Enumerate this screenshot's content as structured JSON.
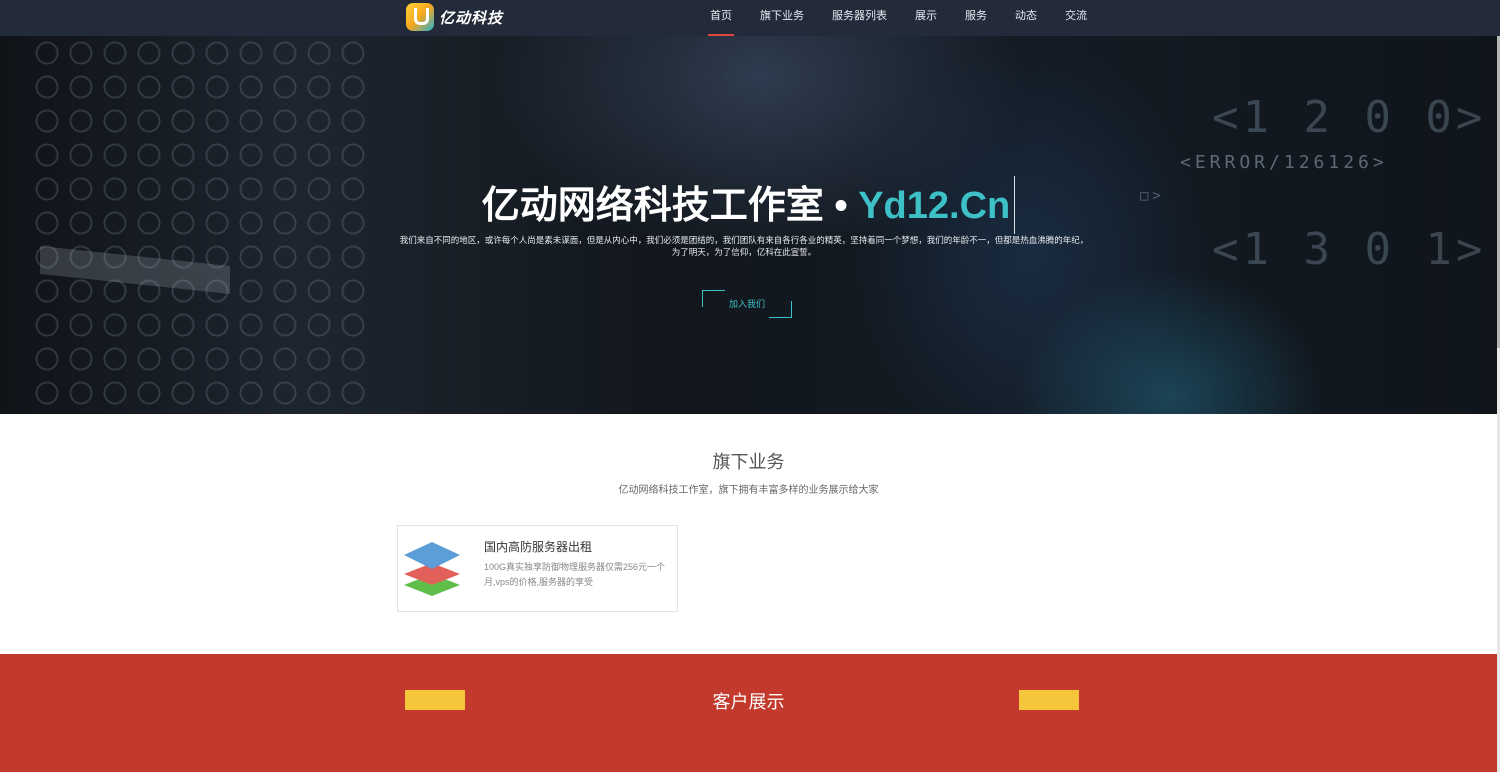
{
  "brand": {
    "logo_text": "亿动科技"
  },
  "nav": {
    "items": [
      {
        "label": "首页",
        "active": true
      },
      {
        "label": "旗下业务"
      },
      {
        "label": "服务器列表"
      },
      {
        "label": "展示"
      },
      {
        "label": "服务"
      },
      {
        "label": "动态"
      },
      {
        "label": "交流"
      }
    ]
  },
  "hero": {
    "title_main": "亿动网络科技工作室",
    "title_sep": " • ",
    "title_accent": "Yd12.Cn",
    "description": "我们来自不同的地区，或许每个人尚是素未谋面，但是从内心中，我们必须是团结的，我们团队有来自各行各业的精英，坚持着同一个梦想，我们的年龄不一，但都是热血沸腾的年纪，为了明天，为了信仰，亿科在此宣誓。",
    "join_label": "加入我们",
    "glitch_1": "<ERROR/126126>",
    "glitch_2": "<1 2 0 0>",
    "glitch_3": "<1 3 0 1>",
    "glitch_4": "□>"
  },
  "business": {
    "title": "旗下业务",
    "subtitle": "亿动网络科技工作室，旗下拥有丰富多样的业务展示给大家",
    "cards": [
      {
        "title": "国内高防服务器出租",
        "desc": "100G真实独享防御物理服务器仅需256元一个月,vps的价格,服务器的享受",
        "icon": "layers-icon"
      }
    ]
  },
  "clients": {
    "title": "客户展示"
  },
  "colors": {
    "accent": "#3ec0c7",
    "nav_active": "#e0463a",
    "clients_bg": "#c3392c",
    "yellow": "#f5c63b",
    "topbar": "#232b3a"
  }
}
